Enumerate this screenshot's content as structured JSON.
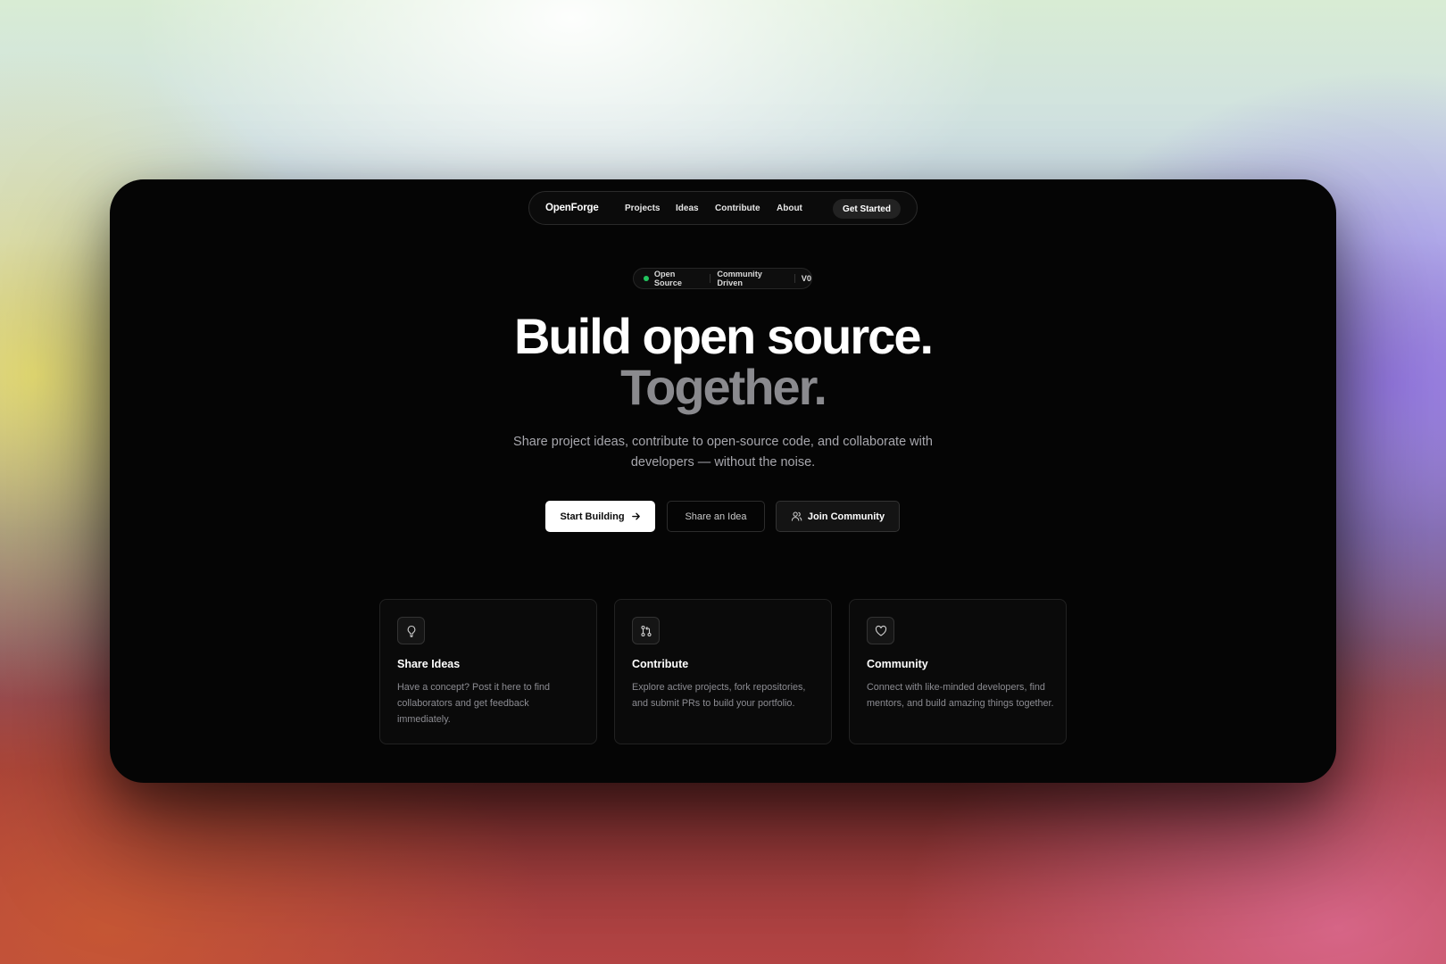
{
  "nav": {
    "brand": "OpenForge",
    "links": [
      "Projects",
      "Ideas",
      "Contribute",
      "About"
    ],
    "cta": "Get Started"
  },
  "badge": {
    "items": [
      "Open Source",
      "Community Driven",
      "V0"
    ],
    "dot_color": "#22c55e"
  },
  "hero": {
    "line1": "Build open source.",
    "line2": "Together.",
    "subtitle": "Share project ideas, contribute to open-source code, and collaborate with developers — without the noise."
  },
  "actions": {
    "primary": "Start Building",
    "secondary": "Share an Idea",
    "tertiary": "Join Community"
  },
  "features": [
    {
      "icon": "lightbulb-icon",
      "title": "Share Ideas",
      "description": "Have a concept? Post it here to find collaborators and get feedback immediately."
    },
    {
      "icon": "git-pull-request-icon",
      "title": "Contribute",
      "description": "Explore active projects, fork repositories, and submit PRs to build your portfolio."
    },
    {
      "icon": "heart-icon",
      "title": "Community",
      "description": "Connect with like-minded developers, find mentors, and build amazing things together."
    }
  ],
  "colors": {
    "background": "#050505",
    "accent_green": "#22c55e",
    "muted_headline": "#8a8a8e"
  }
}
